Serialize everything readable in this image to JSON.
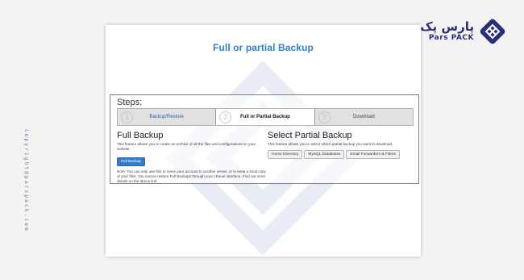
{
  "watermark": {
    "text": "copyright@parspack.com"
  },
  "brand": {
    "name_fa": "پارس پک",
    "name_en": "Pars PACK",
    "accent": "#2a2f7a",
    "logo_icon": "pars-pack-logo-icon"
  },
  "page": {
    "title": "Full or partial Backup"
  },
  "steps": {
    "heading": "Steps:",
    "items": [
      {
        "number": "1",
        "label": "Backup/Restore",
        "active": false
      },
      {
        "number": "2",
        "label": "Full or Partial Backup",
        "active": true
      },
      {
        "number": "3",
        "label": "Download",
        "active": false
      }
    ]
  },
  "full_backup": {
    "heading": "Full Backup",
    "description": "This feature allows you to create an archive of all the files and configurations on your website.",
    "button_label": "Full Backup",
    "note": "Note: You can only use this to move your account to another server, or to keep a local copy of your files. You cannot restore Full Backups through your cPanel interface. Find out more details on the above link."
  },
  "partial_backup": {
    "heading": "Select Partial Backup",
    "description": "This feature allows you to select which partial backup you want to download.",
    "buttons": [
      "Home Directory",
      "MySQL Databases",
      "Email Forwarders & Filters"
    ]
  },
  "colors": {
    "title": "#2d7fd5",
    "primary_button": "#2f7fd1",
    "link": "#2e5fa3"
  }
}
